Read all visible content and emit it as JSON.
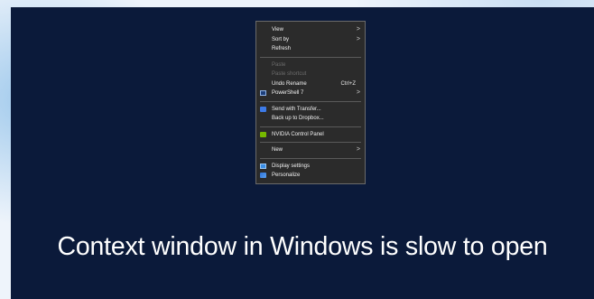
{
  "context_menu": {
    "items": [
      {
        "label": "View",
        "arrow": ">"
      },
      {
        "label": "Sort by",
        "arrow": ">"
      },
      {
        "label": "Refresh"
      },
      {
        "label": "Paste"
      },
      {
        "label": "Paste shortcut"
      },
      {
        "label": "Undo Rename",
        "shortcut": "Ctrl+Z"
      },
      {
        "label": "PowerShell 7",
        "arrow": ">"
      },
      {
        "label": "Send with Transfer..."
      },
      {
        "label": "Back up to Dropbox..."
      },
      {
        "label": "NVIDIA Control Panel"
      },
      {
        "label": "New",
        "arrow": ">"
      },
      {
        "label": "Display settings"
      },
      {
        "label": "Personalize"
      }
    ],
    "icons": {
      "powershell": "powershell-icon",
      "transfer": "dropbox-transfer-icon",
      "nvidia": "nvidia-icon",
      "display": "display-settings-icon",
      "personalize": "personalize-icon"
    }
  },
  "caption": "Context window in Windows is slow to open",
  "colors": {
    "panel_bg": "#0b1a3a",
    "menu_bg": "#2b2b2b",
    "disabled_text": "#6d6d6d"
  }
}
